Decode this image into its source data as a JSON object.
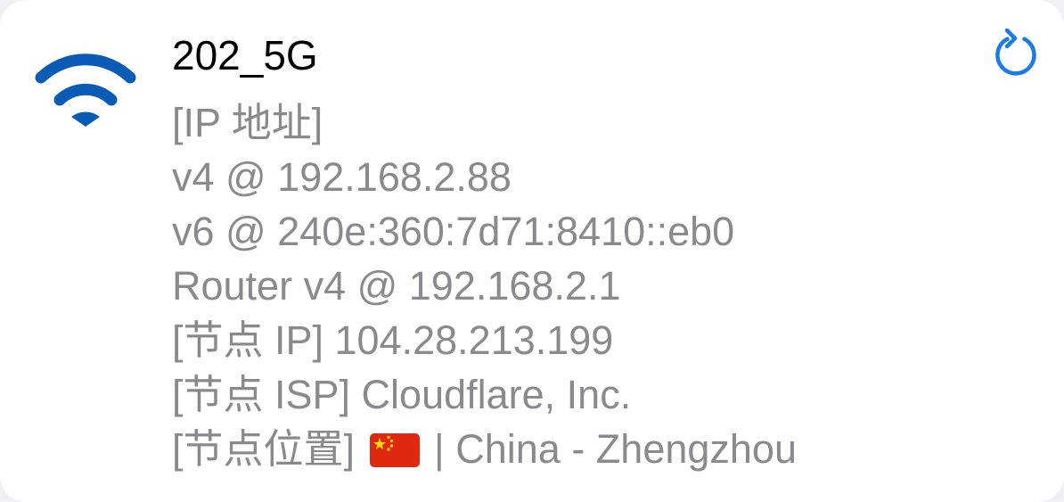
{
  "network": {
    "ssid": "202_5G",
    "icon": "wifi-icon"
  },
  "refresh": {
    "icon": "refresh-icon",
    "color": "#1a7ce8"
  },
  "info": {
    "ip_header": "[IP 地址]",
    "v4": "v4 @ 192.168.2.88",
    "v6": "v6 @ 240e:360:7d71:8410::eb0",
    "router_v4": "Router v4 @ 192.168.2.1",
    "node_ip": "[节点 IP] 104.28.213.199",
    "node_isp": "[节点 ISP] Cloudflare, Inc.",
    "node_location_label": "[节点位置]",
    "node_location_flag": "flag-china-icon",
    "node_location_value": "| China - Zhengzhou"
  },
  "colors": {
    "wifi": "#0a5bb6",
    "primary_text": "#000000",
    "secondary_text": "#8a8a8e",
    "accent": "#1a7ce8"
  }
}
